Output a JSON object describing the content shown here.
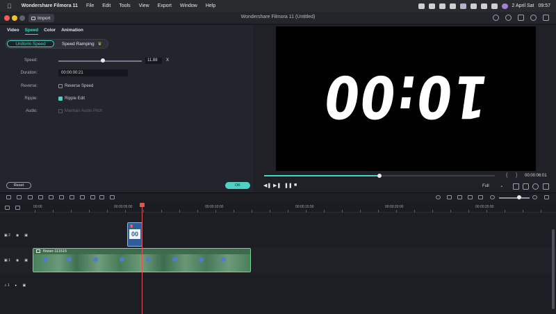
{
  "menubar": {
    "app": "Wondershare Filmora 11",
    "items": [
      "File",
      "Edit",
      "Tools",
      "View",
      "Export",
      "Window",
      "Help"
    ],
    "date": "2 April Sat",
    "time": "09:57"
  },
  "titlebar": {
    "import_label": "Import",
    "title": "Wondershare Filmora 11 (Untitled)"
  },
  "panel": {
    "tabs": [
      "Video",
      "Speed",
      "Color",
      "Animation"
    ],
    "active_tab": "Speed",
    "mode_uniform": "Uniform Speed",
    "mode_ramping": "Speed Ramping",
    "speed_label": "Speed:",
    "speed_value": "11.88",
    "speed_x": "X",
    "speed_level": 0.53,
    "duration_label": "Duration:",
    "duration_value": "00:00:00:21",
    "reverse_label": "Reverse:",
    "reverse_option": "Reverse Speed",
    "ripple_label": "Ripple:",
    "ripple_option": "Ripple Edit",
    "audio_label": "Audio:",
    "audio_option": "Maintain Audio Pitch",
    "reset_label": "Reset",
    "ok_label": "OK"
  },
  "preview": {
    "clock_display": "10:00",
    "timecode": "00:00:06:01",
    "progress": 0.5,
    "quality": "Full"
  },
  "timeline": {
    "ruler": [
      "00:00",
      "00:00:05:00",
      "00:00:10:00",
      "00:00:15:00",
      "00:00:20:00",
      "00:00:25:00"
    ],
    "track_labels": [
      "2",
      "1",
      "1"
    ],
    "title_clip_label": "00",
    "video_clip_name": "flower-111515"
  },
  "colors": {
    "accent": "#4fd1c5",
    "playhead": "#e05656",
    "video_clip": "#6fd88f",
    "title_clip": "#2c5e9c"
  }
}
